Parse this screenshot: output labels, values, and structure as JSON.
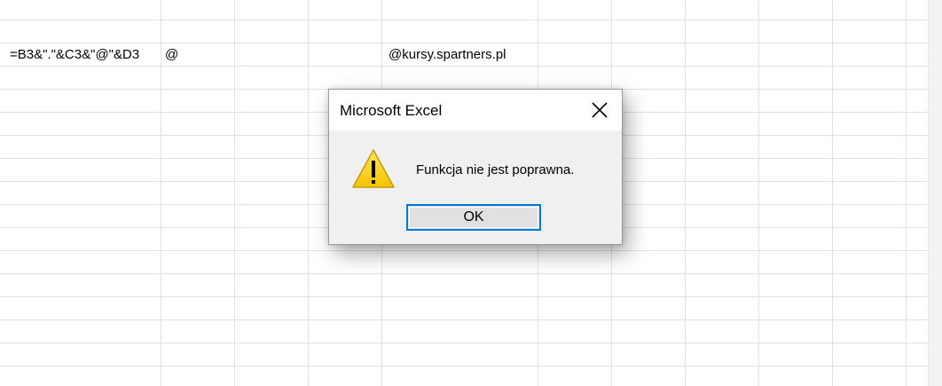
{
  "sheet": {
    "cells": {
      "formula": "=B3&\".\"&C3&\"@\"&D3",
      "at_sign": "@",
      "domain": "@kursy.spartners.pl"
    }
  },
  "dialog": {
    "title": "Microsoft Excel",
    "close_icon": "close-icon",
    "icon": "warning-icon",
    "message": "Funkcja nie jest poprawna.",
    "ok_label": "OK"
  },
  "colors": {
    "accent": "#0078d7",
    "warning_fill": "#fcd116",
    "gridline": "#e1e1e1"
  }
}
